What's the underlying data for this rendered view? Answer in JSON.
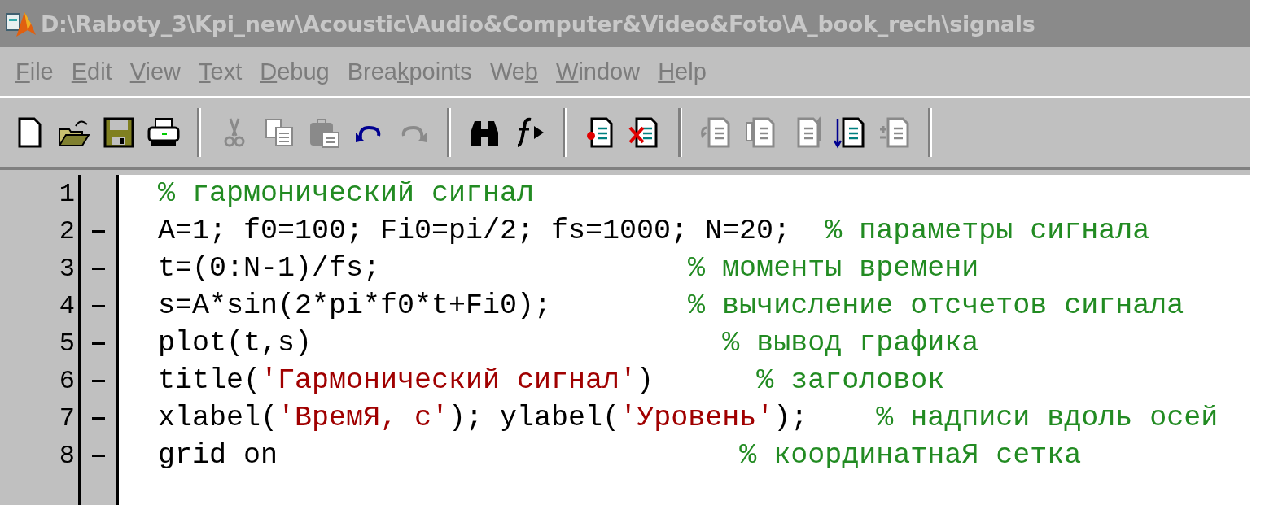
{
  "window": {
    "title": "D:\\Raboty_3\\Kpi_new\\Acoustic\\Audio&Computer&Video&Foto\\A_book_rech\\signals",
    "active": false
  },
  "menu": [
    {
      "parts": [
        {
          "text": "F",
          "underlined": true
        },
        {
          "text": "ile",
          "underlined": false
        }
      ]
    },
    {
      "parts": [
        {
          "text": "E",
          "underlined": true
        },
        {
          "text": "dit",
          "underlined": false
        }
      ]
    },
    {
      "parts": [
        {
          "text": "V",
          "underlined": true
        },
        {
          "text": "iew",
          "underlined": false
        }
      ]
    },
    {
      "parts": [
        {
          "text": "T",
          "underlined": true
        },
        {
          "text": "ext",
          "underlined": false
        }
      ]
    },
    {
      "parts": [
        {
          "text": "D",
          "underlined": true
        },
        {
          "text": "ebug",
          "underlined": false
        }
      ]
    },
    {
      "parts": [
        {
          "text": "Brea",
          "underlined": false
        },
        {
          "text": "k",
          "underlined": true
        },
        {
          "text": "points",
          "underlined": false
        }
      ]
    },
    {
      "parts": [
        {
          "text": "We",
          "underlined": false
        },
        {
          "text": "b",
          "underlined": true
        }
      ]
    },
    {
      "parts": [
        {
          "text": "W",
          "underlined": true
        },
        {
          "text": "indow",
          "underlined": false
        }
      ]
    },
    {
      "parts": [
        {
          "text": "H",
          "underlined": true
        },
        {
          "text": "elp",
          "underlined": false
        }
      ]
    }
  ],
  "toolbar": {
    "groups": [
      {
        "tools": [
          {
            "disabled": false
          },
          {
            "disabled": false
          },
          {
            "disabled": false
          },
          {
            "disabled": false
          }
        ]
      },
      {
        "tools": [
          {
            "disabled": true
          },
          {
            "disabled": true
          },
          {
            "disabled": true
          },
          {
            "disabled": false
          },
          {
            "disabled": true
          }
        ]
      },
      {
        "tools": [
          {
            "disabled": false
          },
          {
            "disabled": false
          }
        ]
      },
      {
        "tools": [
          {
            "disabled": false
          },
          {
            "disabled": false
          }
        ]
      },
      {
        "tools": [
          {
            "disabled": true
          },
          {
            "disabled": true
          },
          {
            "disabled": true
          },
          {
            "disabled": false
          },
          {
            "disabled": true
          }
        ]
      }
    ]
  },
  "editor": {
    "lines": [
      {
        "number": "1",
        "executable": false,
        "tokens": [
          {
            "kind": "comment",
            "text": "% гармонический сигнал"
          }
        ]
      },
      {
        "number": "2",
        "executable": true,
        "tokens": [
          {
            "kind": "code",
            "text": "A=1; f0=100; Fi0=pi/2; fs=1000; N=20;  "
          },
          {
            "kind": "comment",
            "text": "% параметры сигнала"
          }
        ]
      },
      {
        "number": "3",
        "executable": true,
        "tokens": [
          {
            "kind": "code",
            "text": "t=(0:N-1)/fs;                  "
          },
          {
            "kind": "comment",
            "text": "% моменты времени"
          }
        ]
      },
      {
        "number": "4",
        "executable": true,
        "tokens": [
          {
            "kind": "code",
            "text": "s=A*sin(2*pi*f0*t+Fi0);        "
          },
          {
            "kind": "comment",
            "text": "% вычисление отсчетов сигнала"
          }
        ]
      },
      {
        "number": "5",
        "executable": true,
        "tokens": [
          {
            "kind": "code",
            "text": "plot(t,s)                        "
          },
          {
            "kind": "comment",
            "text": "% вывод графика"
          }
        ]
      },
      {
        "number": "6",
        "executable": true,
        "tokens": [
          {
            "kind": "code",
            "text": "title("
          },
          {
            "kind": "string",
            "text": "'Гармонический сигнал'"
          },
          {
            "kind": "code",
            "text": ")      "
          },
          {
            "kind": "comment",
            "text": "% заголовок"
          }
        ]
      },
      {
        "number": "7",
        "executable": true,
        "tokens": [
          {
            "kind": "code",
            "text": "xlabel("
          },
          {
            "kind": "string",
            "text": "'ВремЯ, с'"
          },
          {
            "kind": "code",
            "text": "); ylabel("
          },
          {
            "kind": "string",
            "text": "'Уровень'"
          },
          {
            "kind": "code",
            "text": ");    "
          },
          {
            "kind": "comment",
            "text": "% надписи вдоль осей"
          }
        ]
      },
      {
        "number": "8",
        "executable": true,
        "tokens": [
          {
            "kind": "code",
            "text": "grid on                           "
          },
          {
            "kind": "comment",
            "text": "% координатнаЯ сетка"
          }
        ]
      }
    ]
  }
}
